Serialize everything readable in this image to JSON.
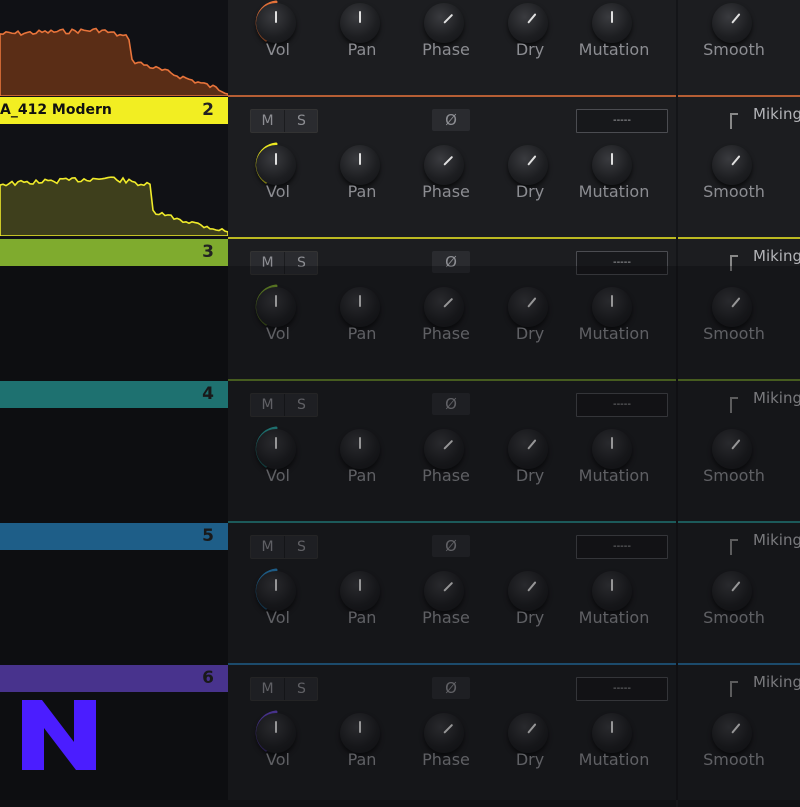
{
  "tracks": [
    {
      "number": "",
      "name": "",
      "color": "#e8743b",
      "fill": "#5a2d16",
      "line": "#e8743b"
    },
    {
      "number": "2",
      "name": "A_412 Modern",
      "color": "#f2ee22",
      "fill": "#3e3f1c",
      "line": "#f0eb2a"
    },
    {
      "number": "3",
      "name": "",
      "color": "#7fab2e"
    },
    {
      "number": "4",
      "name": "",
      "color": "#2aa7a4"
    },
    {
      "number": "5",
      "name": "",
      "color": "#2a8ac9"
    },
    {
      "number": "6",
      "name": "",
      "color": "#6a4ad1"
    }
  ],
  "controls": {
    "mute_label": "M",
    "solo_label": "S",
    "phase_symbol": "Ø",
    "mic_select_value": "-----",
    "miking_label": "Miking"
  },
  "knobs": [
    "Vol",
    "Pan",
    "Phase",
    "Dry",
    "Mutation",
    "Smooth"
  ],
  "logo": {
    "letter": "N",
    "color": "#4b1dff"
  }
}
